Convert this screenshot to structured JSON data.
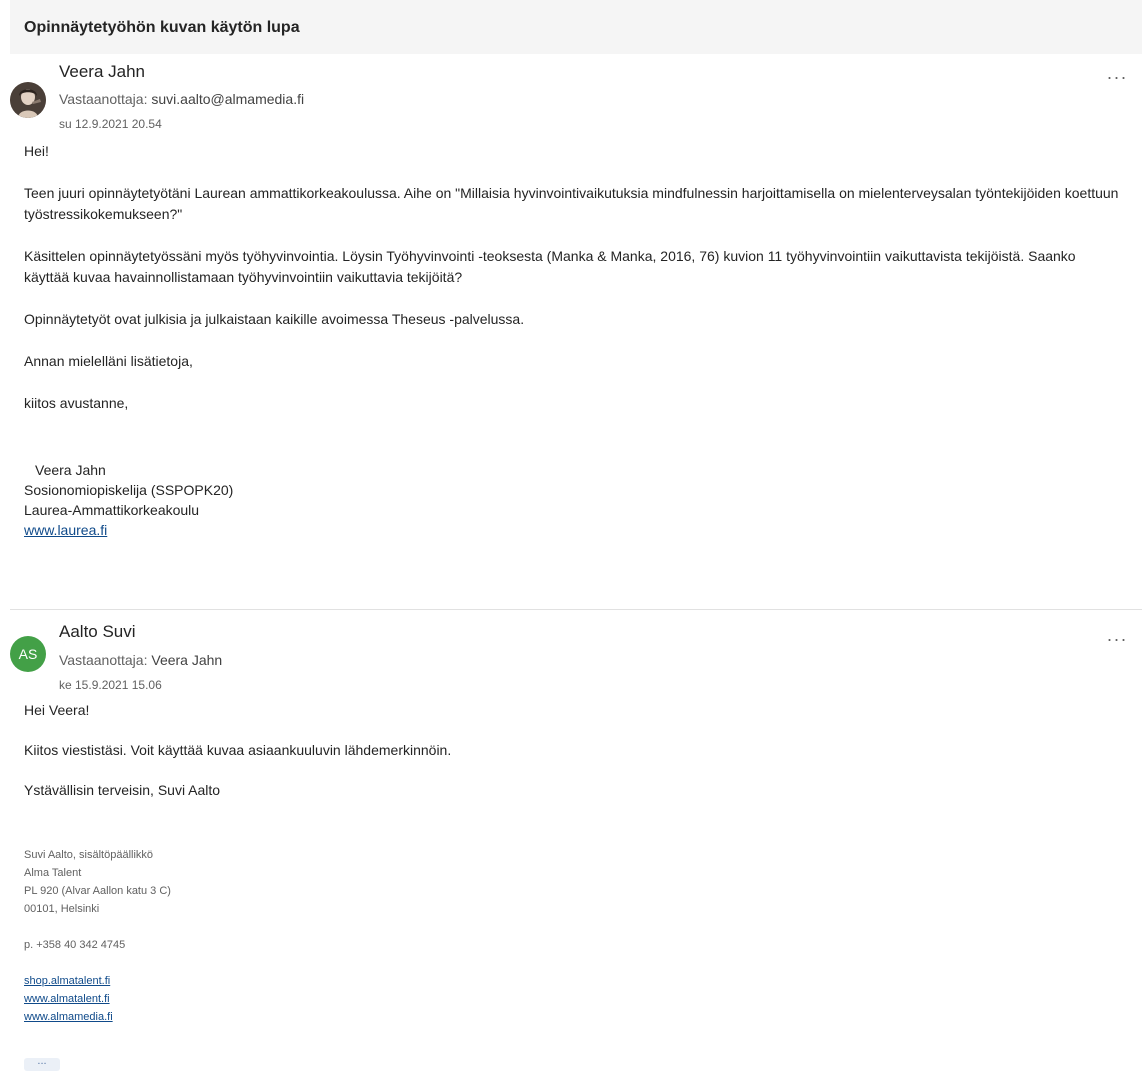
{
  "thread": {
    "subject": "Opinnäytetyöhön kuvan käytön lupa"
  },
  "message1": {
    "sender": "Veera Jahn",
    "recipient_label": "Vastaanottaja:",
    "recipient": "suvi.aalto@almamedia.fi",
    "date": "su 12.9.2021 20.54",
    "more": "...",
    "greeting": "Hei!",
    "para1": "Teen juuri opinnäytetyötäni Laurean ammattikorkeakoulussa. Aihe on \"Millaisia hyvinvointivaikutuksia mindfulnessin harjoittamisella on mielenterveysalan työntekijöiden koettuun työstressikokemukseen?\"",
    "para2": "Käsittelen opinnäytetyössäni myös työhyvinvointia. Löysin Työhyvinvointi -teoksesta (Manka & Manka, 2016, 76) kuvion 11 työhyvinvointiin vaikuttavista tekijöistä. Saanko käyttää kuvaa havainnollistamaan työhyvinvointiin vaikuttavia tekijöitä?",
    "para3": "Opinnäytetyöt ovat julkisia ja julkaistaan kaikille avoimessa Theseus -palvelussa.",
    "para4": "Annan mielelläni lisätietoja,",
    "para5": "kiitos avustanne,",
    "sig_name": "Veera Jahn",
    "sig_title": "Sosionomiopiskelija (SSPOPK20)",
    "sig_org": "Laurea-Ammattikorkeakoulu",
    "sig_link": "www.laurea.fi"
  },
  "message2": {
    "initials": "AS",
    "sender": "Aalto Suvi",
    "recipient_label": "Vastaanottaja:",
    "recipient": "Veera Jahn",
    "date": "ke 15.9.2021 15.06",
    "more": "...",
    "greeting": "Hei Veera!",
    "para1": "Kiitos viestistäsi. Voit käyttää kuvaa asiaankuuluvin lähdemerkinnöin.",
    "para2": "Ystävällisin terveisin, Suvi Aalto",
    "sig_line1": "Suvi Aalto, sisältöpäällikkö",
    "sig_line2": "Alma Talent",
    "sig_line3": "PL 920 (Alvar Aallon katu 3 C)",
    "sig_line4": "00101, Helsinki",
    "sig_phone": "p. +358 40 342 4745",
    "link1": "shop.almatalent.fi",
    "link2": "www.almatalent.fi",
    "link3": "www.almamedia.fi",
    "expand": "..."
  },
  "colors": {
    "avatar_green": "#43a047",
    "link": "#0f4a8a",
    "subject_bg": "#f5f5f5"
  }
}
